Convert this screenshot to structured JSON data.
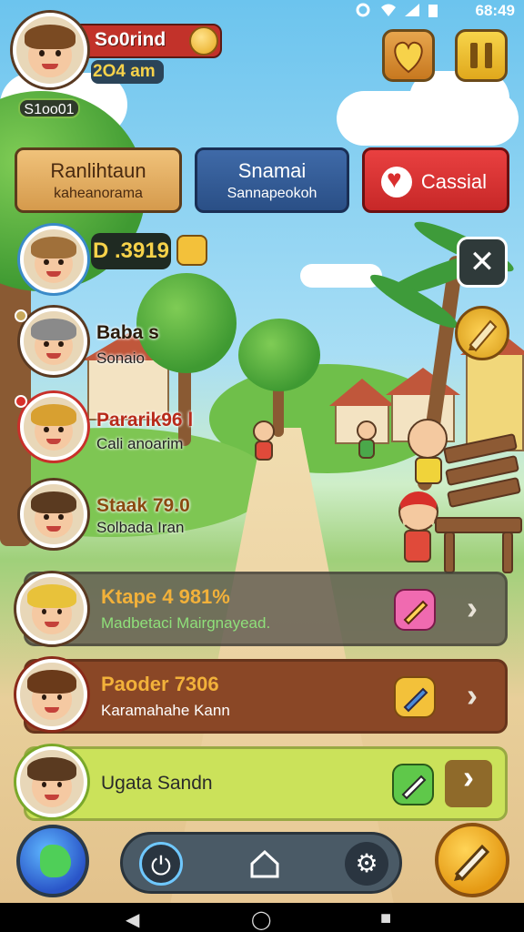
{
  "status_bar": {
    "time": "68:49"
  },
  "player": {
    "name": "So0rind",
    "subtitle": "2O4 am",
    "level_tag": "S1oo01"
  },
  "tabs": [
    {
      "title": "Ranlihtaun",
      "subtitle": "kaheanorama"
    },
    {
      "title": "Snamai",
      "subtitle": "Sannapeokoh"
    },
    {
      "title": "Cassial",
      "subtitle": ""
    }
  ],
  "friends": [
    {
      "score": "D .3919"
    },
    {
      "name": "Baba s",
      "subtitle": "Sonaio"
    },
    {
      "name": "Pararik96 l",
      "subtitle": "Cali anoarim"
    },
    {
      "name": "Staak 79.0",
      "subtitle": "Solbada Iran"
    }
  ],
  "rows": [
    {
      "name": "Ktape 4 981%",
      "desc": "Madbetaci Mairgnayead."
    },
    {
      "name": "Paoder 7306",
      "desc": "Karamahahe Kann"
    },
    {
      "name": "Ugata Sandn",
      "desc": ""
    }
  ],
  "icons": {
    "heart_button": "shield-heart-icon",
    "pause_button": "pause-icon",
    "close_button": "close-icon",
    "tool_button": "pencil-tool-icon",
    "globe_button": "globe-icon",
    "pencil_button": "pencil-icon",
    "nav": [
      "power-icon",
      "home-icon",
      "gear-icon"
    ]
  },
  "colors": {
    "accent_red": "#c72828",
    "accent_blue": "#2a4f86",
    "accent_gold": "#f2b13a",
    "row_green": "#cbe25a"
  }
}
